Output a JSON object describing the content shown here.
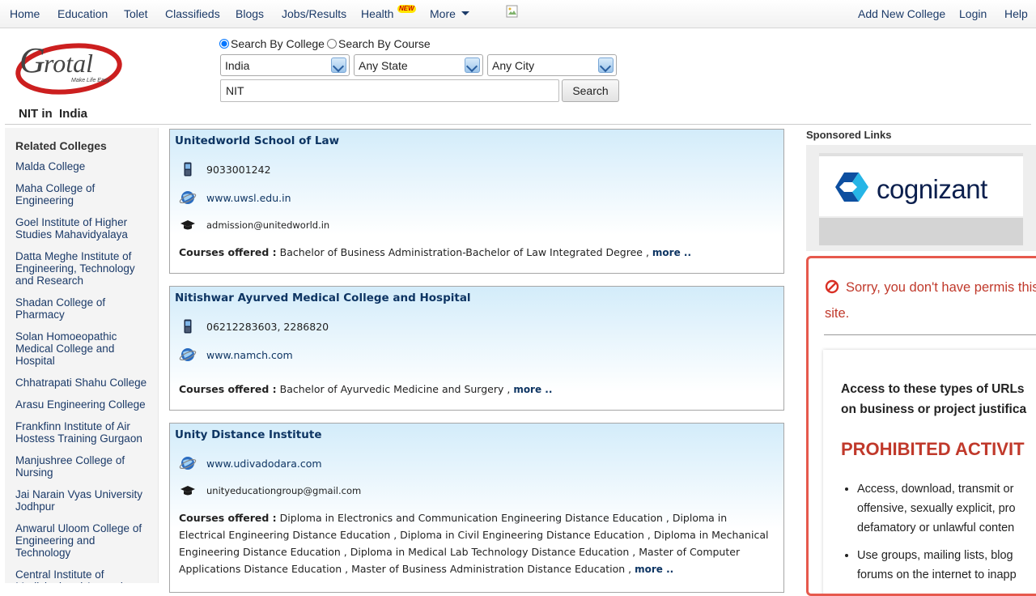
{
  "nav": {
    "home": "Home",
    "education": "Education",
    "tolet": "Tolet",
    "classifieds": "Classifieds",
    "blogs": "Blogs",
    "jobs": "Jobs/Results",
    "health": "Health",
    "new_badge": "NEW",
    "more": "More",
    "add_college": "Add New College",
    "login": "Login",
    "help": "Help"
  },
  "logo": {
    "brand": "rotal",
    "tagline": "Make Life Easy"
  },
  "page_heading": "NIT in  India",
  "search": {
    "radio_college": "Search By College",
    "radio_course": "Search By Course",
    "country": "India",
    "state": "Any State",
    "city": "Any City",
    "query": "NIT",
    "button": "Search"
  },
  "sidebar": {
    "title": "Related Colleges",
    "items": [
      "Malda College",
      "Maha College of Engineering",
      "Goel Institute of Higher Studies Mahavidyalaya",
      "Datta Meghe Institute of Engineering, Technology and Research",
      "Shadan College of Pharmacy",
      "Solan Homoeopathic Medical College and Hospital",
      "Chhatrapati Shahu College",
      "Arasu Engineering College",
      "Frankfinn Institute of Air Hostess Training Gurgaon",
      "Manjushree College of Nursing",
      "Jai Narain Vyas University Jodhpur",
      "Anwarul Uloom College of Engineering and Technology",
      "Central Institute of Medicinal and Aromatic Plants"
    ]
  },
  "listings": [
    {
      "name": "Unitedworld School of Law",
      "phone": "9033001242",
      "website": "www.uwsl.edu.in",
      "email": "admission@unitedworld.in",
      "courses_label": "Courses offered :",
      "courses": "Bachelor of Business Administration-Bachelor of Law Integrated Degree ,",
      "more": "more .."
    },
    {
      "name": "Nitishwar Ayurved Medical College and Hospital",
      "phone": "06212283603, 2286820",
      "website": "www.namch.com",
      "courses_label": "Courses offered :",
      "courses": "Bachelor of Ayurvedic Medicine and Surgery ,",
      "more": "more .."
    },
    {
      "name": "Unity Distance Institute",
      "website": "www.udivadodara.com",
      "email": "unityeducationgroup@gmail.com",
      "courses_label": "Courses offered :",
      "courses": "Diploma in Electronics and Communication Engineering Distance Education , Diploma in Electrical Engineering Distance Education , Diploma in Civil Engineering Distance Education , Diploma in Mechanical Engineering Distance Education , Diploma in Medical Lab Technology Distance Education , Master of Computer Applications Distance Education , Master of Business Administration Distance Education ,",
      "more": "more .."
    }
  ],
  "sponsored": {
    "title": "Sponsored Links",
    "ad_text": "cognizant"
  },
  "blocked": {
    "message": "Sorry, you don't have permis this site.",
    "access": "Access to these types of URLs on business or project justifica",
    "prohibited": "PROHIBITED ACTIVIT",
    "bullets": [
      "Access, download, transmit or offensive, sexually explicit, pro defamatory or unlawful conten",
      "Use groups, mailing lists, blog forums on the internet to inapp"
    ]
  },
  "colors": {
    "link_navy": "#1b3a68",
    "card_top": "#d3ecfa",
    "alert_red": "#c0392b",
    "brand_red": "#cc1f1f"
  }
}
